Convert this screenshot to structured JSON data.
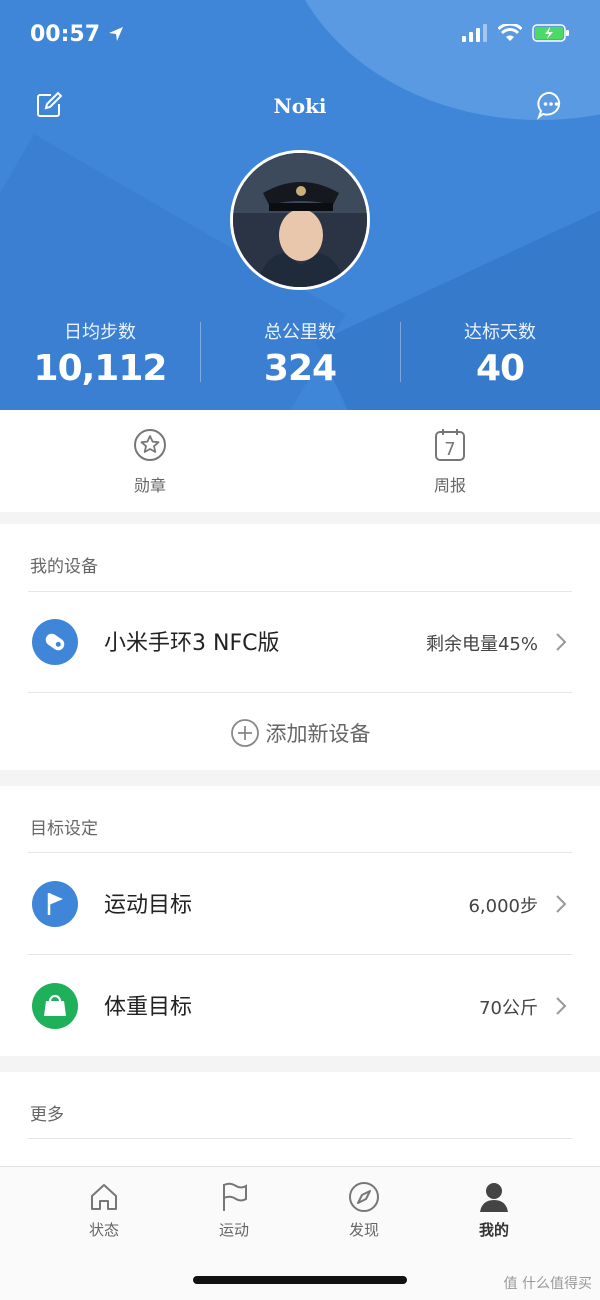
{
  "status": {
    "time": "00:57"
  },
  "header": {
    "title": "Noki"
  },
  "stats": [
    {
      "label": "日均步数",
      "value": "10,112"
    },
    {
      "label": "总公里数",
      "value": "324"
    },
    {
      "label": "达标天数",
      "value": "40"
    }
  ],
  "quick": [
    {
      "label": "勋章",
      "icon": "medal-icon"
    },
    {
      "label": "周报",
      "icon": "calendar-icon",
      "day": "7"
    }
  ],
  "devices": {
    "title": "我的设备",
    "item": {
      "name": "小米手环3 NFC版",
      "value": "剩余电量45%"
    },
    "add_label": "添加新设备"
  },
  "goals": {
    "title": "目标设定",
    "items": [
      {
        "label": "运动目标",
        "value": "6,000步",
        "color": "#3f86d8"
      },
      {
        "label": "体重目标",
        "value": "70公斤",
        "color": "#1fb05a"
      }
    ]
  },
  "more": {
    "title": "更多"
  },
  "tabs": [
    {
      "label": "状态"
    },
    {
      "label": "运动"
    },
    {
      "label": "发现"
    },
    {
      "label": "我的"
    }
  ],
  "watermark": "值 什么值得买",
  "colors": {
    "accent": "#3f86d8",
    "green": "#1fb05a"
  }
}
